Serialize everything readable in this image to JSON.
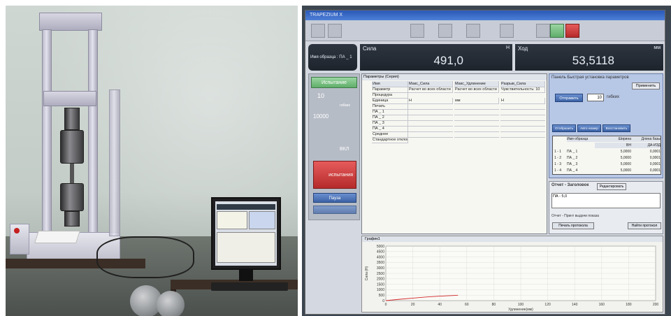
{
  "right_screen": {
    "sample_name": "Имя образца : ПА _ 1",
    "force_label": "Сила",
    "force_unit": "Н",
    "force_value": "491,0",
    "travel_label": "Ход",
    "travel_unit": "мм",
    "travel_value": "53,5118",
    "test_button": "Испытание",
    "count_value": "10",
    "count_unit": "гибких",
    "max_label": "10000",
    "on_label": "ВКЛ",
    "stop_button": "испытания",
    "pause_button": "Пауза",
    "table_panel_title": "Параметры (Серия)",
    "table_headers": [
      "Имя",
      "Макс_Сила",
      "Макс_Удлинение",
      "Разрыв_Сила"
    ],
    "table_param_row": [
      "Параметр",
      "Расчет во всех области",
      "Расчет во всех области",
      "Чувствительность: 10"
    ],
    "table_rows": [
      [
        "Процедура",
        "",
        "",
        ""
      ],
      [
        "Единица",
        "Н",
        "мм",
        "Н"
      ],
      [
        "Печать",
        "",
        "",
        ""
      ],
      [
        "ПА _ 1",
        "",
        "",
        ""
      ],
      [
        "ПА _ 2",
        "",
        "",
        ""
      ],
      [
        "ПА _ 3",
        "",
        "",
        ""
      ],
      [
        "ПА _ 4",
        "",
        "",
        ""
      ],
      [
        "Среднее",
        "",
        "",
        ""
      ],
      [
        "Стандартное отклонение",
        "",
        "",
        ""
      ]
    ],
    "right_panel_title": "Панель Быстрая установка параметров",
    "apply_button": "Применить",
    "send_button": "Отправить",
    "send_value": "10",
    "send_unit": "гибких",
    "small_buttons": [
      "Отобразить",
      "Авто номер",
      "Восстановить"
    ],
    "side_table_headers": [
      "Имя образца",
      "Ширина",
      "Длина базы"
    ],
    "side_table_units": [
      "",
      "ВН",
      "ДА-ИЗД"
    ],
    "side_table_rows": [
      [
        "1 - 1",
        "ПА _ 1",
        "5,0000",
        "0,0001"
      ],
      [
        "1 - 2",
        "ПА _ 2",
        "5,0000",
        "0,0001"
      ],
      [
        "1 - 3",
        "ПА _ 3",
        "5,0000",
        "0,0001"
      ],
      [
        "1 - 4",
        "ПА _ 4",
        "5,0000",
        "0,0001"
      ]
    ],
    "report_title": "Отчет - Заголовок",
    "report_edit_button": "Редактировать",
    "report_text": "ПА - 5,0",
    "report_footer": "Отчет - Принт выдачи показа",
    "print_button": "Печать протокола",
    "find_button": "Найти протокол",
    "graph_title": "График1",
    "graph_ylabel": "Сила (Н)",
    "graph_xlabel": "Удлинение(мм)"
  },
  "chart_data": {
    "type": "line",
    "xlabel": "Удлинение(мм)",
    "ylabel": "Сила (Н)",
    "xlim": [
      0,
      200
    ],
    "ylim": [
      0,
      5000
    ],
    "x_ticks": [
      "0",
      "20",
      "40",
      "60",
      "80",
      "100",
      "120",
      "140",
      "160",
      "180",
      "200"
    ],
    "y_ticks": [
      "0",
      "500",
      "1000",
      "1500",
      "2000",
      "2500",
      "3000",
      "3500",
      "4000",
      "4500",
      "5000"
    ],
    "series": [
      {
        "x": [
          0,
          10,
          20,
          30,
          40,
          50,
          53.5
        ],
        "y": [
          0,
          120,
          230,
          330,
          410,
          470,
          491
        ],
        "color": "#d22a2a"
      }
    ]
  }
}
